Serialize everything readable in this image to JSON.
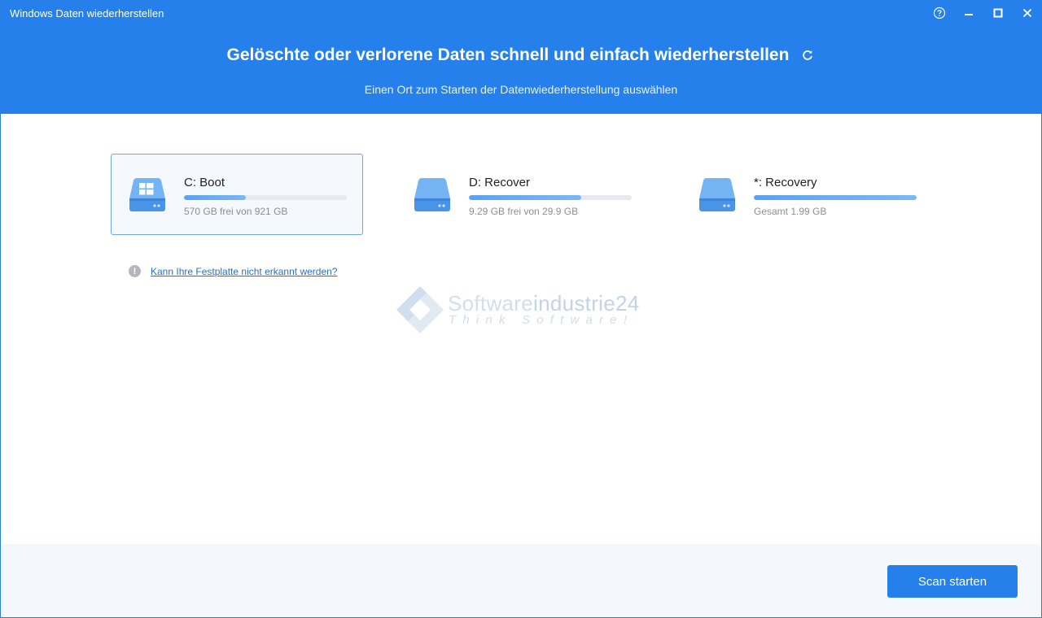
{
  "window": {
    "title": "Windows Daten wiederherstellen",
    "controls": [
      "help-icon",
      "minimize-icon",
      "maximize-icon",
      "close-icon"
    ]
  },
  "header": {
    "title": "Gelöschte oder verlorene Daten schnell und einfach wiederherstellen",
    "subtitle": "Einen Ort zum Starten der Datenwiederherstellung auswählen",
    "refresh_icon": "refresh-icon"
  },
  "drives": [
    {
      "name": "C: Boot",
      "info": "570 GB frei von 921 GB",
      "used_fraction": 0.38,
      "selected": true,
      "icon": "windows-drive-icon"
    },
    {
      "name": "D: Recover",
      "info": "9.29 GB frei von 29.9 GB",
      "used_fraction": 0.69,
      "selected": false,
      "icon": "drive-icon"
    },
    {
      "name": "*: Recovery",
      "info": "Gesamt 1.99 GB",
      "used_fraction": 1.0,
      "selected": false,
      "icon": "drive-icon"
    }
  ],
  "hint": {
    "icon": "info-icon",
    "link_text": "Kann Ihre Festplatte nicht erkannt werden?"
  },
  "watermark": {
    "brand_part1": "Software",
    "brand_part2": "industrie24",
    "tagline": "Think Software!"
  },
  "footer": {
    "scan_label": "Scan starten"
  },
  "colors": {
    "accent": "#2580ec",
    "selected_border": "#6aa8ee",
    "link": "#2a6fc9"
  }
}
